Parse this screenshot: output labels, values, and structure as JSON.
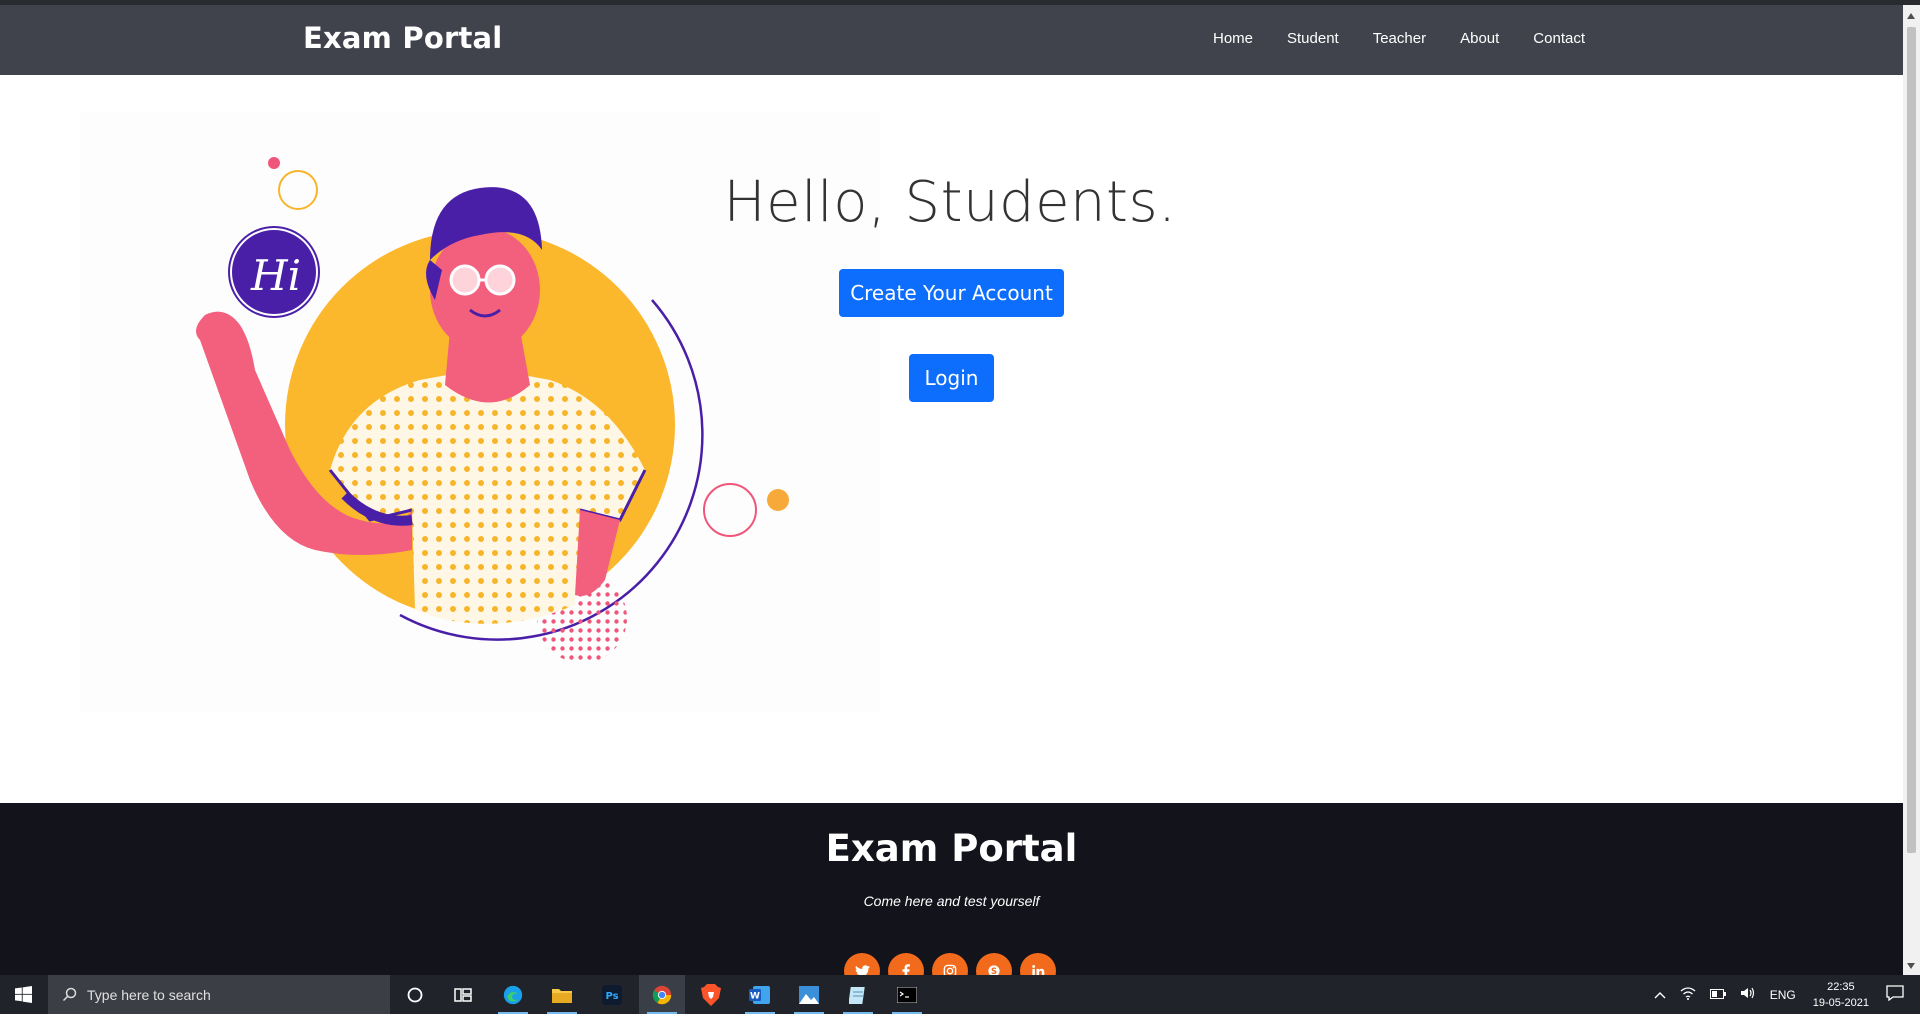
{
  "navbar": {
    "brand": "Exam Portal",
    "links": [
      "Home",
      "Student",
      "Teacher",
      "About",
      "Contact"
    ]
  },
  "hero": {
    "greeting": "Hello, Students.",
    "create_button": "Create Your Account",
    "login_button": "Login",
    "illustration_text": "Hi"
  },
  "footer": {
    "title": "Exam Portal",
    "tagline": "Come here and test yourself",
    "social_icons": [
      "twitter-icon",
      "facebook-icon",
      "instagram-icon",
      "skype-icon",
      "linkedin-icon"
    ]
  },
  "taskbar": {
    "search_placeholder": "Type here to search",
    "language": "ENG",
    "time": "22:35",
    "date": "19-05-2021",
    "apps": [
      "cortana-icon",
      "task-view-icon",
      "edge-icon",
      "file-explorer-icon",
      "photoshop-icon",
      "chrome-icon",
      "brave-icon",
      "word-icon",
      "photos-icon",
      "notepad-icon",
      "terminal-icon"
    ]
  },
  "colors": {
    "navbar": "#41434c",
    "primary_button": "#0d6efd",
    "footer": "#13141b",
    "social": "#f26a1b",
    "taskbar": "#20242a"
  }
}
